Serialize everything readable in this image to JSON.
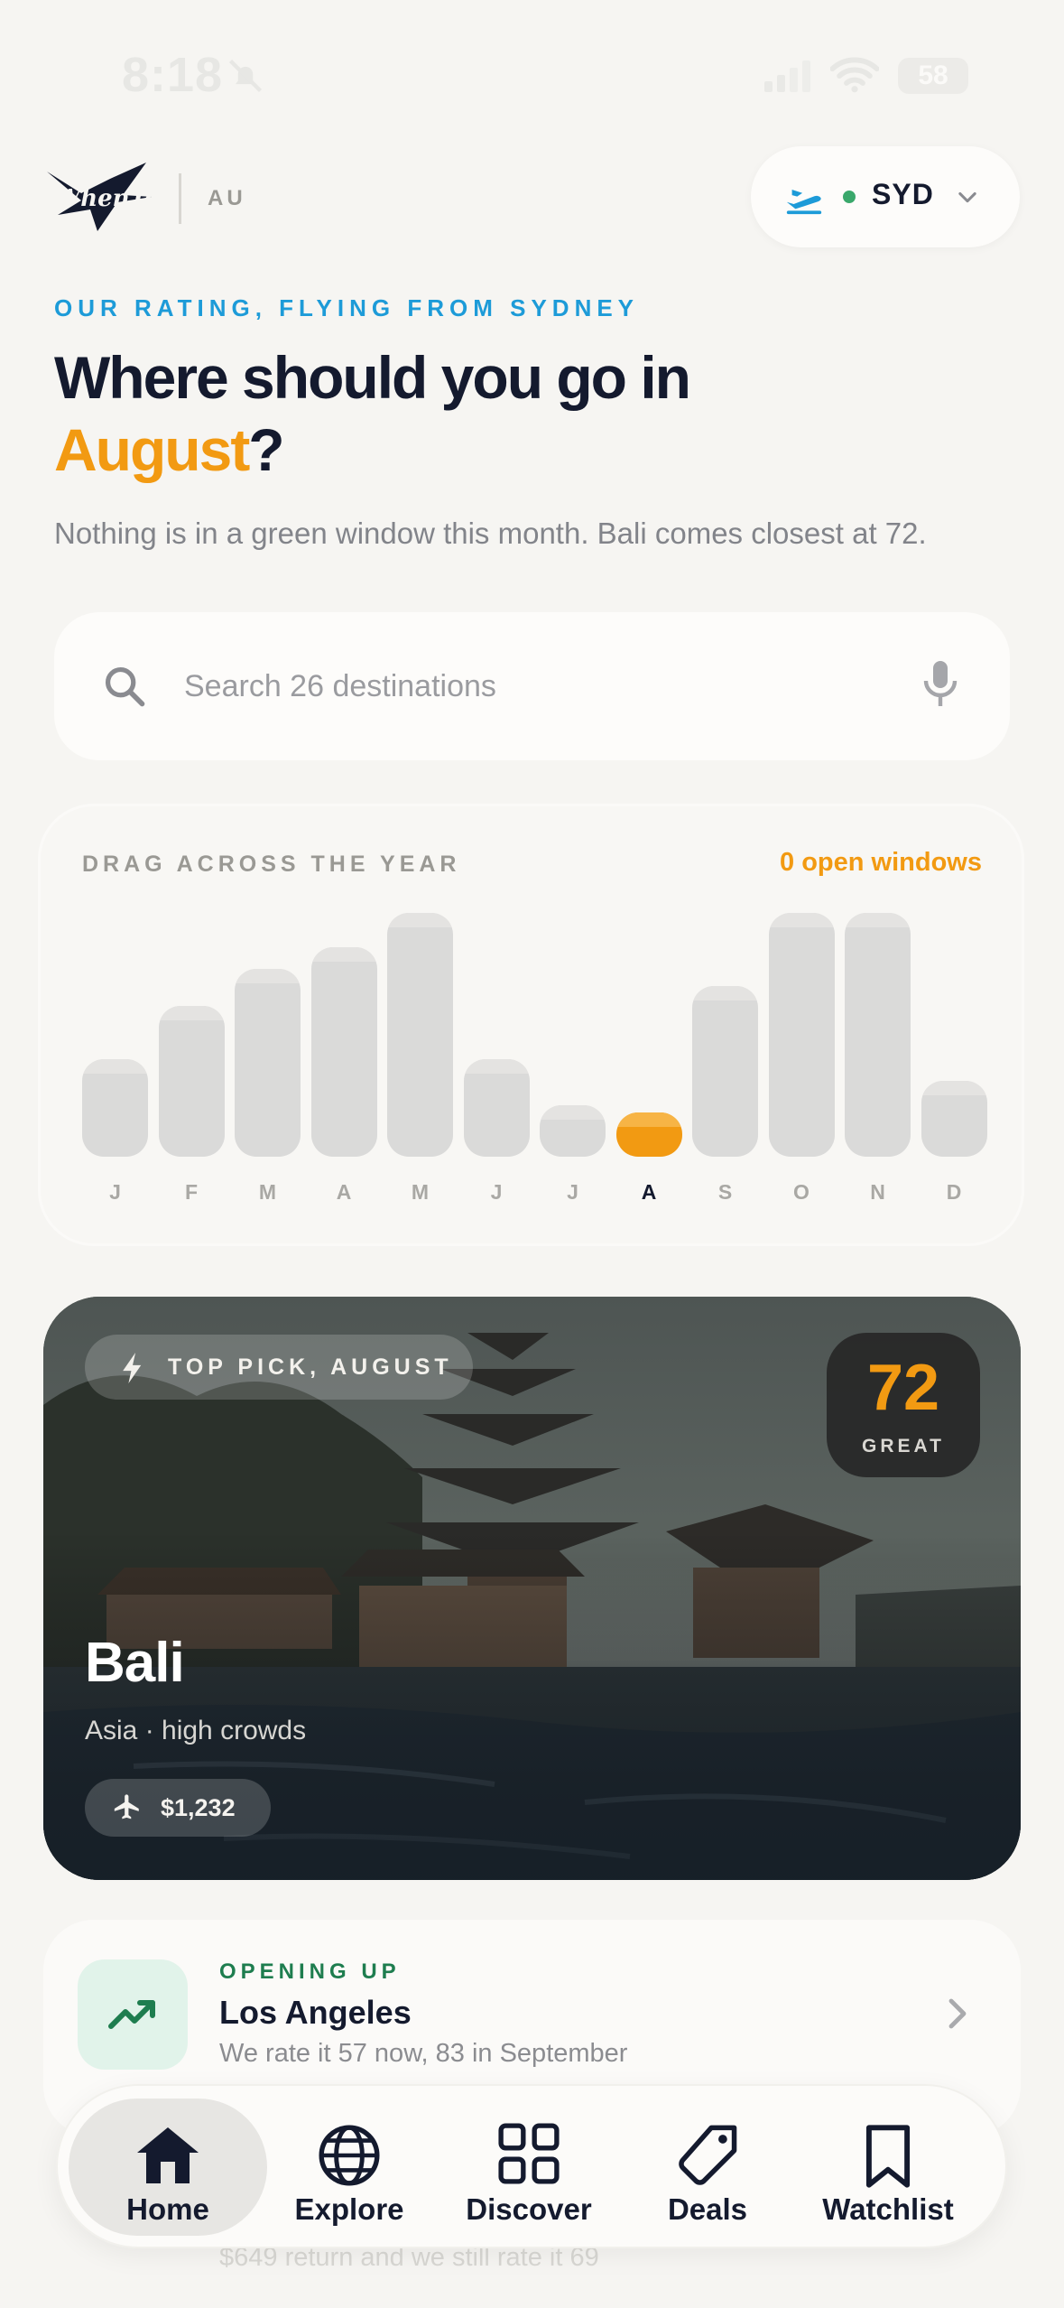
{
  "status_bar": {
    "time": "8:18",
    "battery": "58"
  },
  "header": {
    "logo_text": "WhenToFly",
    "country": "AU",
    "airport_code": "SYD"
  },
  "hero": {
    "eyebrow": "OUR RATING, FLYING FROM SYDNEY",
    "title_prefix": "Where should you go in",
    "month": "August",
    "title_suffix": "?",
    "subtitle": "Nothing is in a green window this month. Bali comes closest at 72."
  },
  "search": {
    "placeholder": "Search 26 destinations"
  },
  "month_picker": {
    "label": "DRAG ACROSS THE YEAR",
    "open_windows": "0 open windows",
    "months": [
      {
        "letter": "J",
        "level": 0.4
      },
      {
        "letter": "F",
        "level": 0.62
      },
      {
        "letter": "M",
        "level": 0.77
      },
      {
        "letter": "A",
        "level": 0.86
      },
      {
        "letter": "M",
        "level": 1.0
      },
      {
        "letter": "J",
        "level": 0.4
      },
      {
        "letter": "J",
        "level": 0.21
      },
      {
        "letter": "A",
        "level": 0.18
      },
      {
        "letter": "S",
        "level": 0.7
      },
      {
        "letter": "O",
        "level": 1.0
      },
      {
        "letter": "N",
        "level": 1.0
      },
      {
        "letter": "D",
        "level": 0.31
      }
    ],
    "active_index": 7
  },
  "top_pick": {
    "badge": "TOP PICK, AUGUST",
    "score": "72",
    "score_label": "GREAT",
    "name": "Bali",
    "meta": "Asia · high crowds",
    "price": "$1,232"
  },
  "opening_up": {
    "eyebrow": "OPENING UP",
    "city": "Los Angeles",
    "description": "We rate it 57 now, 83 in September"
  },
  "next_card_peek": "$649 return and we still rate it 69",
  "nav": {
    "items": [
      {
        "label": "Home",
        "icon": "home-icon",
        "active": true
      },
      {
        "label": "Explore",
        "icon": "globe-icon",
        "active": false
      },
      {
        "label": "Discover",
        "icon": "grid-icon",
        "active": false
      },
      {
        "label": "Deals",
        "icon": "tag-icon",
        "active": false
      },
      {
        "label": "Watchlist",
        "icon": "bookmark-icon",
        "active": false
      }
    ]
  },
  "colors": {
    "accent": "#f29a12",
    "eyebrow_blue": "#1d9bd8",
    "green": "#1e7d4f",
    "ink": "#141a2e",
    "background": "#f6f5f2"
  }
}
